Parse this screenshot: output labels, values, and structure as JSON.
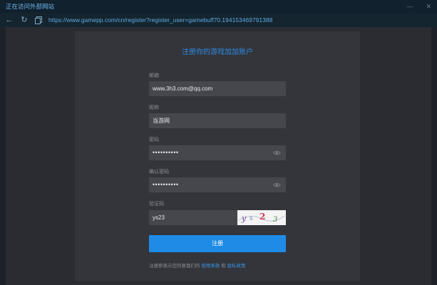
{
  "window": {
    "title": "正在访问外部网站",
    "minimize_icon": "minimize-icon",
    "close_icon": "close-icon"
  },
  "address": {
    "url": "https://www.gamepp.com/cn/register?register_user=gamebuff70.194153469791388"
  },
  "form": {
    "title": "注册你的游戏加加账户",
    "email_label": "邮箱",
    "email_value": "www.3h3.com@qq.com",
    "nickname_label": "昵称",
    "nickname_value": "当游网",
    "password_label": "密码",
    "password_value": "••••••••••",
    "confirm_label": "确认密码",
    "confirm_value": "••••••••••",
    "captcha_label": "验证码",
    "captcha_value": "ys23",
    "captcha_image_text": "y s 2 3",
    "register_label": "注册",
    "terms_prefix": "注册即表示您同意我们的",
    "terms_link": "使用条款",
    "terms_and": "和",
    "privacy_link": "隐私政策"
  },
  "colors": {
    "accent": "#1f8be6",
    "link": "#3b92e4",
    "title": "#2f8ae0"
  }
}
